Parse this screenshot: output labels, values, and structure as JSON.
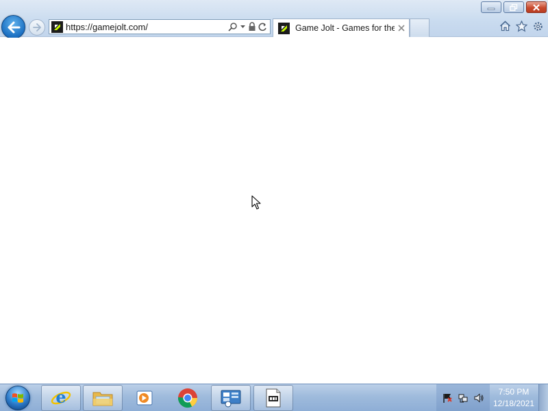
{
  "browser": {
    "address_url": "https://gamejolt.com/",
    "tab_title": "Game Jolt - Games for the l...",
    "window_controls": [
      "minimize",
      "restore",
      "close"
    ],
    "address_icons": [
      "search-icon",
      "dropdown-icon",
      "lock-icon",
      "refresh-icon"
    ],
    "command_icons": [
      "home-icon",
      "favorites-star-icon",
      "settings-gear-icon"
    ]
  },
  "taskbar": {
    "pinned": [
      "internet-explorer-icon",
      "file-explorer-icon",
      "media-player-icon",
      "chrome-icon",
      "control-panel-icon",
      "notepad-icon"
    ],
    "tray_icons": [
      "action-center-flag-icon",
      "network-icon",
      "volume-icon"
    ],
    "clock_time": "7:50 PM",
    "clock_date": "12/18/2021"
  },
  "colors": {
    "chrome_bg": "#c9dbef",
    "taskbar_bg": "#9fbbdc",
    "close_red": "#c94b2f",
    "back_blue": "#1b6fc2"
  }
}
